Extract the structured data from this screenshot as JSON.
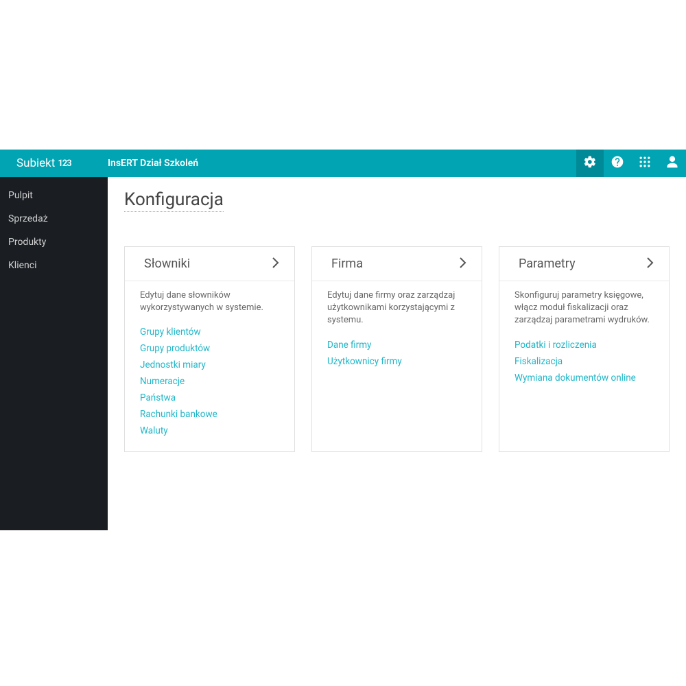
{
  "header": {
    "logo_text": "Subiekt",
    "logo_suffix": "123",
    "org_name": "InsERT Dział Szkoleń"
  },
  "sidebar": {
    "items": [
      {
        "label": "Pulpit"
      },
      {
        "label": "Sprzedaż"
      },
      {
        "label": "Produkty"
      },
      {
        "label": "Klienci"
      }
    ]
  },
  "page": {
    "title": "Konfiguracja"
  },
  "cards": [
    {
      "title": "Słowniki",
      "desc": "Edytuj dane słowników wykorzystywanych w systemie.",
      "links": [
        "Grupy klientów",
        "Grupy produktów",
        "Jednostki miary",
        "Numeracje",
        "Państwa",
        "Rachunki bankowe",
        "Waluty"
      ]
    },
    {
      "title": "Firma",
      "desc": "Edytuj dane firmy oraz zarządzaj użytkownikami korzystającymi z systemu.",
      "links": [
        "Dane firmy",
        "Użytkownicy firmy"
      ]
    },
    {
      "title": "Parametry",
      "desc": "Skonfiguruj parametry księgowe, włącz moduł fiskalizacji oraz zarządzaj parametrami wydruków.",
      "links": [
        "Podatki i rozliczenia",
        "Fiskalizacja",
        "Wymiana dokumentów online"
      ]
    }
  ]
}
